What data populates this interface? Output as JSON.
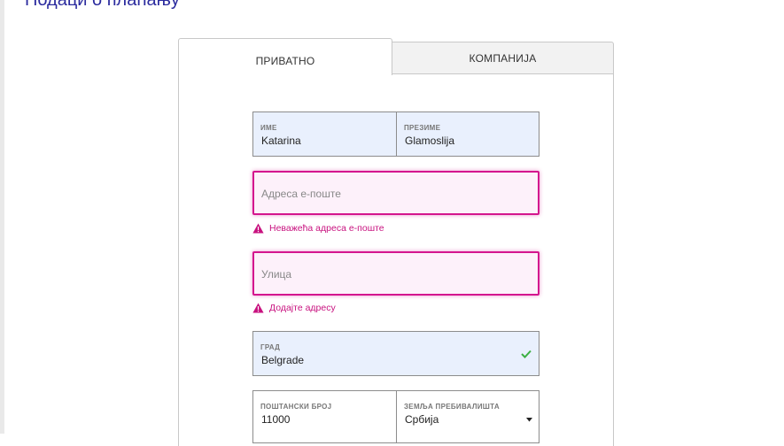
{
  "section": {
    "title": "Подаци о плаћању"
  },
  "tabs": [
    {
      "label": "ПРИВАТНО",
      "active": true
    },
    {
      "label": "КОМПАНИЈА",
      "active": false
    }
  ],
  "form": {
    "first_name": {
      "label": "ИМЕ",
      "value": "Katarina"
    },
    "last_name": {
      "label": "ПРЕЗИМЕ",
      "value": "Glamoslija"
    },
    "email": {
      "placeholder": "Адреса е-поште",
      "error": "Неважећа адреса е-поште"
    },
    "street": {
      "placeholder": "Улица",
      "error": "Додајте адресу"
    },
    "city": {
      "label": "ГРАД",
      "value": "Belgrade"
    },
    "postal_code": {
      "label": "ПОШТАНСКИ БРОЈ",
      "value": "11000"
    },
    "country": {
      "label": "ЗЕМЉА ПРЕБИВАЛИШТА",
      "value": "Србија"
    }
  },
  "colors": {
    "field_bg": "#e9f0fd",
    "error": "#d4168e",
    "error_bg": "#fdf1fa",
    "valid_check": "#3cb043",
    "title": "#2b2b9e"
  },
  "icons": {
    "warning": "warning-triangle-icon",
    "valid": "check-icon",
    "dropdown": "caret-down-icon"
  }
}
